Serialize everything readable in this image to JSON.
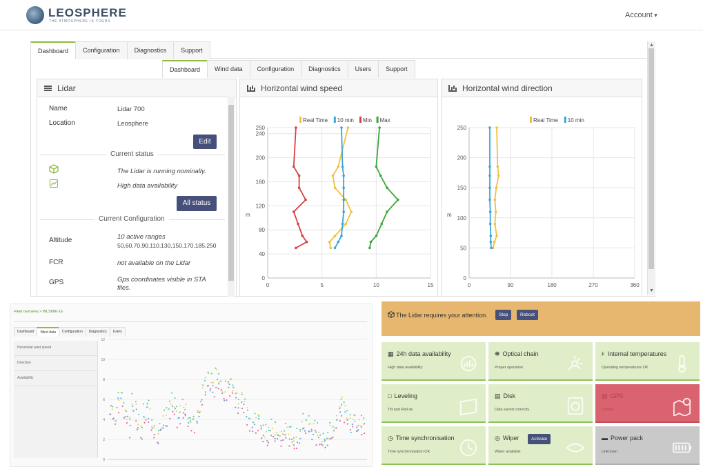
{
  "header": {
    "brand": "LEOSPHERE",
    "tagline": "THE ATMOSPHERE IS YOURS",
    "account": "Account"
  },
  "outer_tabs": [
    {
      "label": "Dashboard",
      "active": true
    },
    {
      "label": "Configuration",
      "active": false
    },
    {
      "label": "Diagnostics",
      "active": false
    },
    {
      "label": "Support",
      "active": false
    }
  ],
  "inner_tabs": [
    {
      "label": "Dashboard",
      "active": true
    },
    {
      "label": "Wind data",
      "active": false
    },
    {
      "label": "Configuration",
      "active": false
    },
    {
      "label": "Diagnostics",
      "active": false
    },
    {
      "label": "Users",
      "active": false
    },
    {
      "label": "Support",
      "active": false
    }
  ],
  "lidar": {
    "title": "Lidar",
    "name_label": "Name",
    "name_value": "Lidar 700",
    "location_label": "Location",
    "location_value": "Leosphere",
    "edit_button": "Edit",
    "current_status": "Current status",
    "status_1": "The Lidar is running nominally.",
    "status_2": "High data availability",
    "all_status_button": "All status",
    "current_configuration": "Current Configuration",
    "altitude_label": "Altitude",
    "altitude_value": "10 active ranges",
    "altitude_list": "50,60,70,90,110,130,150,170,185,250",
    "fcr_label": "FCR",
    "fcr_value": "not available on the Lidar",
    "gps_label": "GPS",
    "gps_value": "Gps coordinates visible in STA files."
  },
  "chart_data": [
    {
      "type": "line",
      "title": "Horizontal wind speed",
      "ylabel": "m",
      "xlim": [
        0,
        15
      ],
      "ylim": [
        0,
        250
      ],
      "xticks": [
        0,
        5,
        10,
        15
      ],
      "yticks": [
        0,
        40,
        80,
        120,
        160,
        200,
        240,
        250
      ],
      "legend": [
        "Real Time",
        "10 min",
        "Min",
        "Max"
      ],
      "grid": true,
      "y": [
        50,
        60,
        70,
        90,
        110,
        130,
        150,
        170,
        185,
        250
      ],
      "series": [
        {
          "name": "Real Time",
          "color": "#f0c040",
          "x": [
            5.8,
            5.7,
            6.2,
            7.2,
            7.7,
            7.2,
            6.2,
            6.0,
            6.5,
            7.4
          ]
        },
        {
          "name": "10 min",
          "color": "#3aa5d8",
          "x": [
            6.2,
            6.5,
            6.8,
            6.9,
            7.0,
            7.0,
            7.0,
            7.0,
            6.9,
            6.8
          ]
        },
        {
          "name": "Min",
          "color": "#d94040",
          "x": [
            2.6,
            3.6,
            3.2,
            2.8,
            2.4,
            3.5,
            2.9,
            2.9,
            2.4,
            2.6
          ]
        },
        {
          "name": "Max",
          "color": "#3aa63a",
          "x": [
            9.4,
            9.5,
            10.0,
            10.5,
            11.0,
            12.0,
            11.0,
            10.4,
            10.0,
            10.3
          ]
        }
      ]
    },
    {
      "type": "line",
      "title": "Horizontal wind direction",
      "ylabel": "m",
      "xlim": [
        0,
        360
      ],
      "ylim": [
        0,
        250
      ],
      "xticks": [
        0,
        90,
        180,
        270,
        360
      ],
      "yticks": [
        0,
        50,
        100,
        150,
        200,
        250
      ],
      "legend": [
        "Real Time",
        "10 min"
      ],
      "grid": true,
      "y": [
        50,
        60,
        70,
        90,
        110,
        130,
        150,
        170,
        185,
        250
      ],
      "series": [
        {
          "name": "Real Time",
          "color": "#f0c040",
          "x": [
            52,
            55,
            60,
            56,
            58,
            56,
            59,
            64,
            62,
            60
          ]
        },
        {
          "name": "10 min",
          "color": "#3aa5d8",
          "x": [
            48,
            47,
            47,
            46,
            46,
            45,
            45,
            45,
            45,
            45
          ]
        }
      ]
    },
    {
      "type": "scatter",
      "title": "",
      "ylim": [
        0,
        12
      ],
      "yticks": [
        0,
        2,
        4,
        6,
        8,
        10,
        12
      ],
      "series_colors": [
        "#e86a9a",
        "#5fb0e8",
        "#f0d060",
        "#6fd0a0"
      ],
      "profile": [
        5.2,
        4.6,
        4.0,
        5.8,
        6.4,
        5.0,
        4.2,
        3.4,
        5.6,
        4.8,
        3.6,
        3.0,
        4.4,
        5.2,
        4.8,
        3.6,
        2.8,
        2.4,
        3.4,
        4.2,
        4.0,
        4.8,
        5.4,
        5.0,
        4.4,
        4.6,
        5.2,
        4.8,
        4.0,
        3.6,
        3.8,
        4.2,
        5.0,
        6.4,
        7.4,
        8.0,
        7.6,
        7.0,
        8.4,
        7.8,
        7.2,
        6.6,
        7.0,
        7.6,
        7.2,
        6.4,
        5.8,
        6.0,
        5.4,
        4.6,
        4.0,
        3.6,
        3.4,
        3.8,
        3.2,
        2.6,
        2.4,
        2.8,
        3.2,
        2.8,
        2.2,
        2.0,
        2.4,
        2.6,
        2.2,
        2.0,
        1.8,
        2.2,
        2.8,
        3.4,
        3.6,
        3.2,
        2.8,
        3.0,
        2.6,
        2.2,
        2.0,
        1.8,
        2.2,
        2.6,
        3.0,
        3.8,
        4.8,
        5.6,
        4.8,
        3.8,
        3.4,
        3.8,
        3.6,
        3.2,
        3.4,
        3.6
      ]
    }
  ],
  "bottom_left": {
    "breadcrumb": "Fleet overview  >  WLS866-16",
    "tabs": [
      "Dashboard",
      "Wind data",
      "Configuration",
      "Diagnostics",
      "Users"
    ],
    "active_tab": "Wind data",
    "side_items": [
      "Horizontal wind speed",
      "Direction",
      "Availability"
    ]
  },
  "alert": {
    "text": "The Lidar requires your attention.",
    "stop_button": "Stop",
    "reboot_button": "Reboot"
  },
  "tiles": [
    {
      "title": "24h data availability",
      "sub": "High data availability",
      "state": "ok",
      "icon": "availability-icon"
    },
    {
      "title": "Optical chain",
      "sub": "Proper operation",
      "state": "ok",
      "icon": "optical-chain-icon"
    },
    {
      "title": "Internal temperatures",
      "sub": "Operating temperatures OK",
      "state": "ok",
      "icon": "thermometer-icon"
    },
    {
      "title": "Leveling",
      "sub": "Tilt and Roll ok",
      "state": "ok",
      "icon": "leveling-icon"
    },
    {
      "title": "Disk",
      "sub": "Data saved correctly",
      "state": "ok",
      "icon": "disk-icon"
    },
    {
      "title": "GPS",
      "sub": "Critical",
      "state": "critical",
      "icon": "map-pin-icon"
    },
    {
      "title": "Time synchronisation",
      "sub": "Time synchronisation OK",
      "state": "ok",
      "icon": "clock-icon"
    },
    {
      "title": "Wiper",
      "sub": "Wiper available",
      "state": "ok",
      "icon": "eye-icon",
      "button": "Activate"
    },
    {
      "title": "Power pack",
      "sub": "Unknown",
      "state": "unknown",
      "icon": "battery-icon"
    }
  ]
}
